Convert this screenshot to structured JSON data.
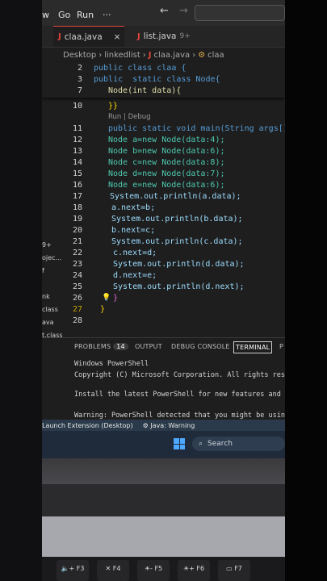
{
  "menu": {
    "view": "w",
    "go": "Go",
    "run": "Run",
    "more": "···"
  },
  "tabs": [
    {
      "icon": "J",
      "label": "claa.java",
      "close": "×",
      "active": true
    },
    {
      "icon": "J",
      "label": "list.java",
      "badge": "9+",
      "active": false
    }
  ],
  "breadcrumb": {
    "root": "Desktop",
    "folder": "linkedlist",
    "file_icon": "J",
    "file": "claa.java",
    "symbol": "claa"
  },
  "code_lens": "Run | Debug",
  "sticky_lines": [
    {
      "n": "2",
      "text": "public class claa {"
    },
    {
      "n": "3",
      "text": "public  static class Node{"
    },
    {
      "n": "7",
      "text": "Node(int data){"
    }
  ],
  "lines": [
    {
      "n": "10",
      "text": "}}"
    },
    {
      "n": "11",
      "text": "public static void main(String args[])"
    },
    {
      "n": "12",
      "text": "Node a=new Node(data:4);"
    },
    {
      "n": "13",
      "text": "Node b=new Node(data:6);"
    },
    {
      "n": "14",
      "text": "Node c=new Node(data:8);"
    },
    {
      "n": "15",
      "text": "Node d=new Node(data:7);"
    },
    {
      "n": "16",
      "text": "Node e=new Node(data:6);"
    },
    {
      "n": "17",
      "text": "System.out.println(a.data);"
    },
    {
      "n": "18",
      "text": "a.next=b;"
    },
    {
      "n": "19",
      "text": "System.out.println(b.data);"
    },
    {
      "n": "20",
      "text": "b.next=c;"
    },
    {
      "n": "21",
      "text": "System.out.println(c.data);"
    },
    {
      "n": "22",
      "text": "c.next=d;"
    },
    {
      "n": "23",
      "text": "System.out.println(d.data);"
    },
    {
      "n": "24",
      "text": "d.next=e;"
    },
    {
      "n": "25",
      "text": "System.out.println(d.next);"
    },
    {
      "n": "26",
      "text": "}"
    },
    {
      "n": "27",
      "text": "}"
    },
    {
      "n": "28",
      "text": ""
    }
  ],
  "sidebar_fragments": [
    "9+",
    "ojec...",
    "f",
    "nk",
    "class",
    "ava",
    "t.class"
  ],
  "panel": {
    "problems": "PROBLEMS",
    "problems_count": "14",
    "output": "OUTPUT",
    "debug": "DEBUG CONSOLE",
    "terminal": "TERMINAL",
    "ports": "P"
  },
  "terminal_lines": [
    "Windows PowerShell",
    "Copyright (C) Microsoft Corporation. All rights rese",
    "",
    "Install the latest PowerShell for new features and i",
    "",
    "Warning: PowerShell detected that you might be using"
  ],
  "status": {
    "launch": "Launch Extension (Desktop)",
    "java": "Java: Warning"
  },
  "taskbar": {
    "search": "Search"
  },
  "keys": [
    {
      "label": "F3",
      "icon": "🔈+"
    },
    {
      "label": "F4",
      "icon": "✕"
    },
    {
      "label": "F5",
      "icon": "☀-"
    },
    {
      "label": "F6",
      "icon": "☀+"
    },
    {
      "label": "F7",
      "icon": "▭"
    }
  ]
}
